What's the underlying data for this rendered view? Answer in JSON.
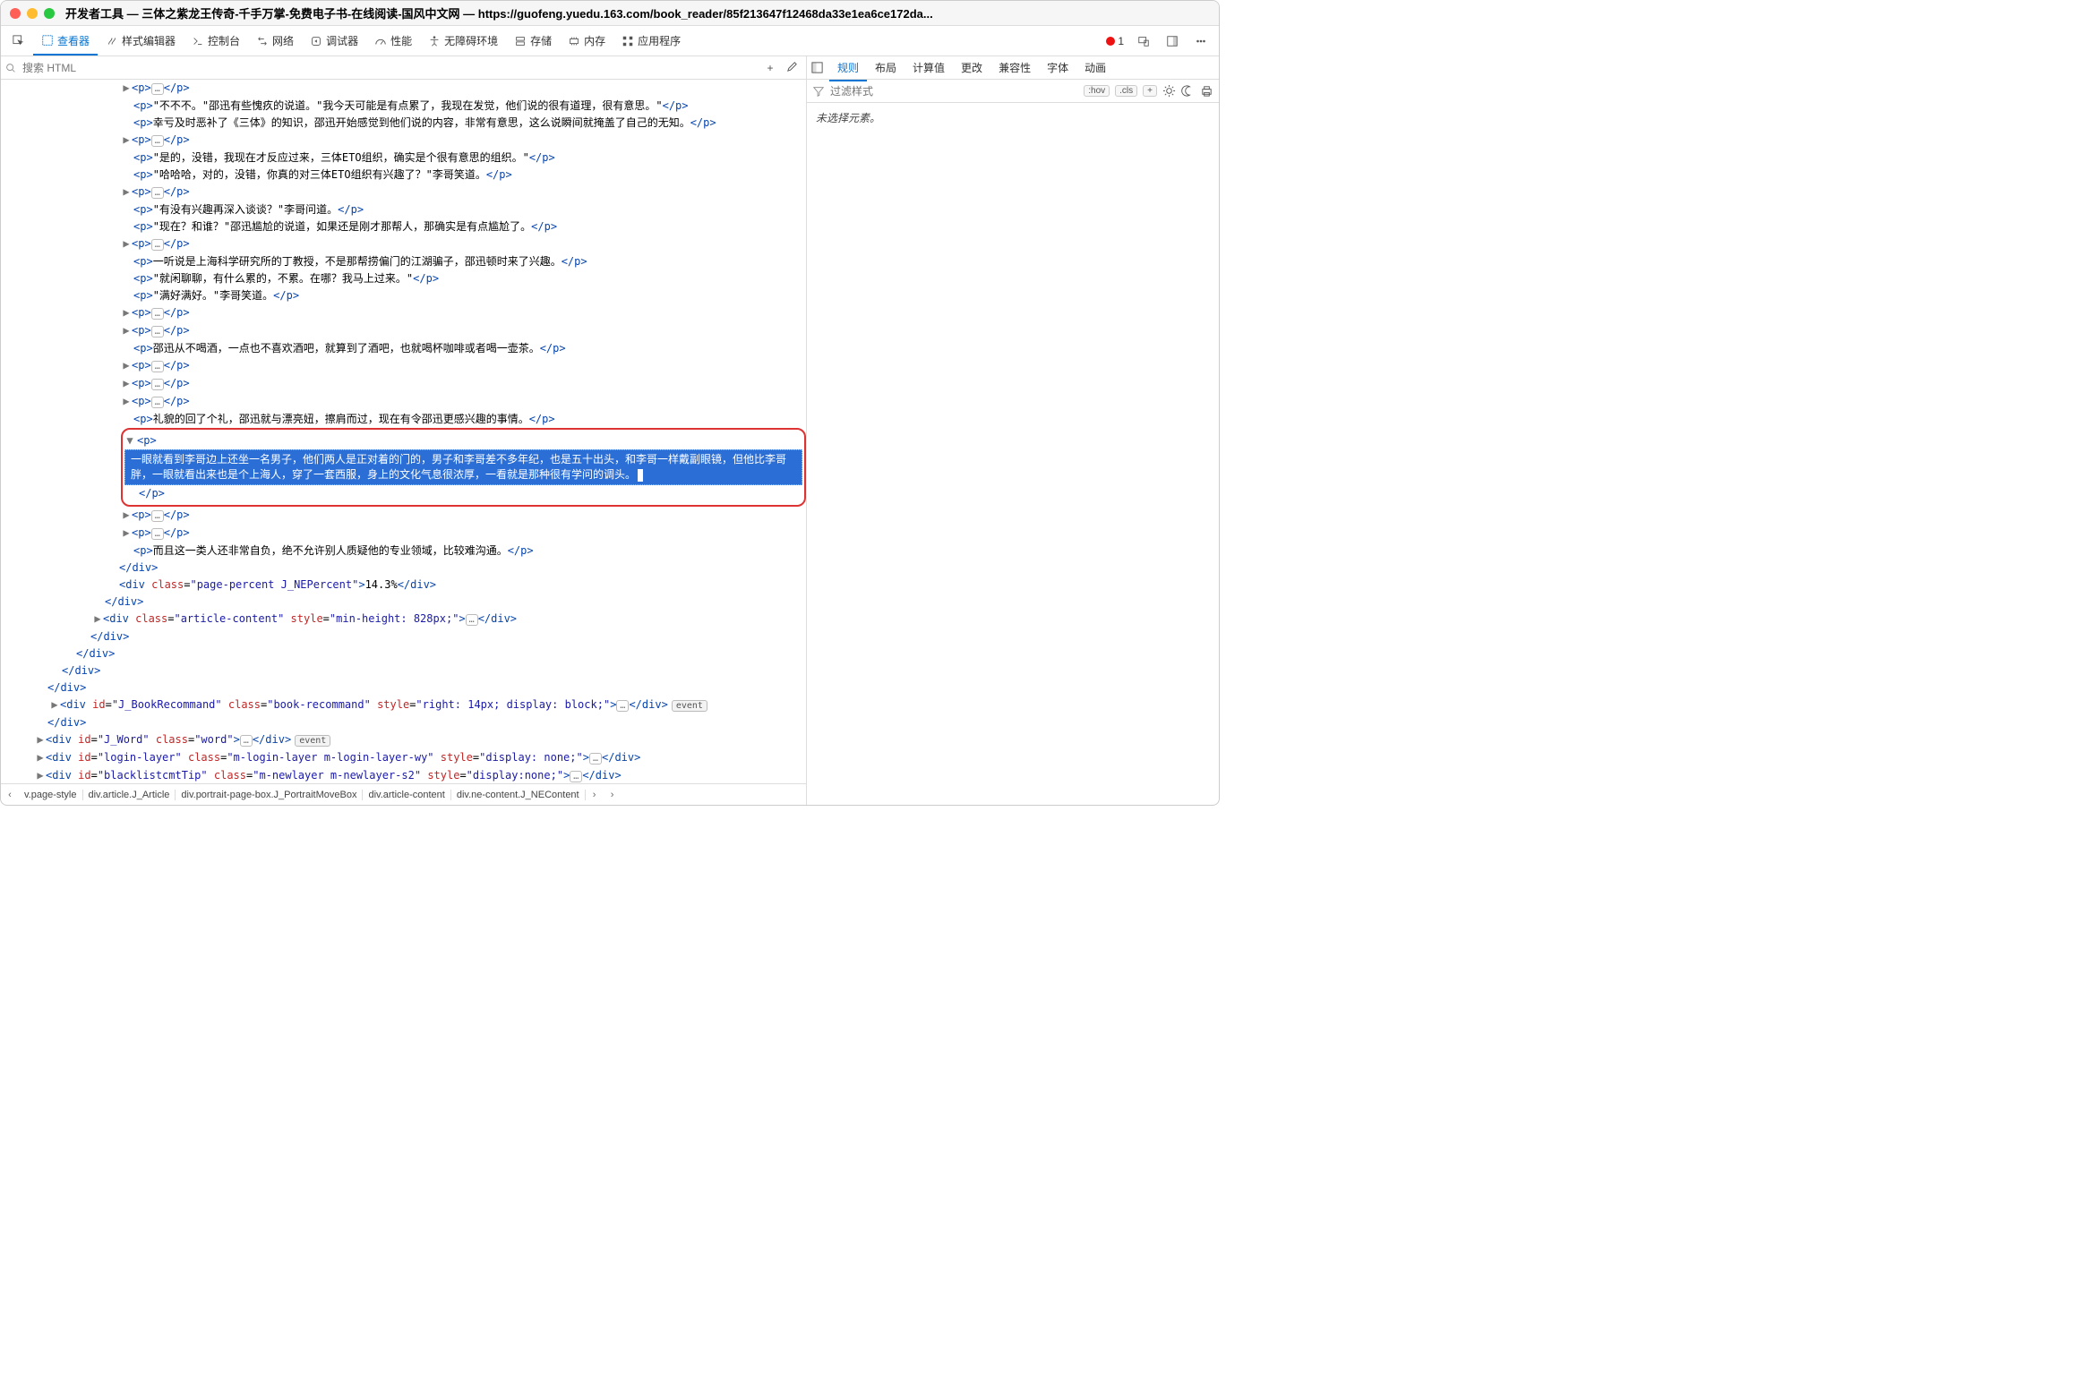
{
  "title": "开发者工具 — 三体之紫龙王传奇-千手万掌-免费电子书-在线阅读-国风中文网 — https://guofeng.yuedu.163.com/book_reader/85f213647f12468da33e1ea6ce172da...",
  "toolbar": {
    "inspector": "查看器",
    "styleeditor": "样式编辑器",
    "console": "控制台",
    "network": "网络",
    "debugger": "调试器",
    "performance": "性能",
    "a11y": "无障碍环境",
    "storage": "存储",
    "memory": "内存",
    "apps": "应用程序",
    "err_count": "1"
  },
  "search": {
    "placeholder": "搜索 HTML"
  },
  "tree": {
    "l0": "<p>…</p>",
    "l1": "\"不不不。\"邵迅有些愧疚的说道。\"我今天可能是有点累了，我现在发觉，他们说的很有道理，很有意思。\"",
    "l2": "幸亏及时恶补了《三体》的知识，邵迅开始感觉到他们说的内容，非常有意思，这么说瞬间就掩盖了自己的无知。",
    "l4": "\"是的，没错，我现在才反应过来，三体ETO组织，确实是个很有意思的组织。\"",
    "l5": "\"哈哈哈，对的，没错，你真的对三体ETO组织有兴趣了？\"李哥笑道。",
    "l7": "\"有没有兴趣再深入谈谈？\"李哥问道。",
    "l8": "\"现在？和谁？\"邵迅尴尬的说道，如果还是刚才那帮人，那确实是有点尴尬了。",
    "l10": "一听说是上海科学研究所的丁教授，不是那帮捞偏门的江湖骗子，邵迅顿时来了兴趣。",
    "l11": "\"就闲聊聊，有什么累的，不累。在哪？我马上过来。\"",
    "l12": "\"满好满好。\"李哥笑道。",
    "l15": "邵迅从不喝酒，一点也不喜欢酒吧，就算到了酒吧，也就喝杯咖啡或者喝一壶茶。",
    "l19": "礼貌的回了个礼，邵迅就与漂亮妞，擦肩而过，现在有令邵迅更感兴趣的事情。",
    "sel": "一眼就看到李哥边上还坐一名男子，他们两人是正对着的门的，男子和李哥差不多年纪，也是五十出头，和李哥一样戴副眼镜，但他比李哥胖，一眼就看出来也是个上海人，穿了一套西服，身上的文化气息很浓厚，一看就是那种很有学问的调头。",
    "l23": "而且这一类人还非常自负，绝不允许别人质疑他的专业领域，比较难沟通。",
    "percent": "14.3%",
    "artstyle": "min-height: 828px;",
    "recstyle": "right: 14px; display: block;",
    "loginstyle": "display: none;",
    "blstyle": "display:none;",
    "rlstyle": "display:none;",
    "bmstyle": "display:none;"
  },
  "crumbs": {
    "c0": "v.page-style",
    "c1": "div.article.J_Article",
    "c2": "div.portrait-page-box.J_PortraitMoveBox",
    "c3": "div.article-content",
    "c4": "div.ne-content.J_NEContent"
  },
  "right": {
    "rules": "规则",
    "layout": "布局",
    "computed": "计算值",
    "changes": "更改",
    "compat": "兼容性",
    "fonts": "字体",
    "anim": "动画",
    "filter_ph": "过滤样式",
    "hov": ":hov",
    "cls": ".cls",
    "msg": "未选择元素。"
  }
}
